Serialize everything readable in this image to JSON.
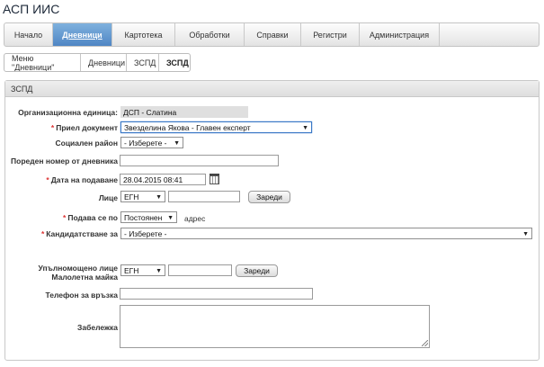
{
  "app": {
    "title": "АСП ИИС"
  },
  "nav": {
    "tabs": [
      {
        "label": "Начало"
      },
      {
        "label": "Дневници",
        "active": true
      },
      {
        "label": "Картотека"
      },
      {
        "label": "Обработки"
      },
      {
        "label": "Справки"
      },
      {
        "label": "Регистри"
      },
      {
        "label": "Администрация"
      }
    ]
  },
  "breadcrumb": [
    {
      "label": "Меню \"Дневници\""
    },
    {
      "label": "Дневници"
    },
    {
      "label": "ЗСПД"
    },
    {
      "label": "ЗСПД"
    }
  ],
  "panel": {
    "title": "ЗСПД"
  },
  "form": {
    "org_unit_label": "Организационна единица:",
    "org_unit_value": "ДСП - Слатина",
    "received_doc_label": "Приел документ",
    "received_doc_value": "Звезделина Якова - Главен експерт",
    "social_region_label": "Социален район",
    "social_region_value": "- Изберете -",
    "journal_number_label": "Пореден номер от дневника",
    "journal_number_value": "",
    "submission_date_label": "Дата на подаване",
    "submission_date_value": "28.04.2015 08:41",
    "person_label": "Лице",
    "person_id_type": "ЕГН",
    "person_id_value": "",
    "load_button": "Зареди",
    "submitted_by_label": "Подава се по",
    "submitted_by_value": "Постоянен",
    "address_suffix": "адрес",
    "application_label": "Кандидатстване за",
    "application_value": "- Изберете -",
    "authorized_label_line1": "Упълномощено лице",
    "authorized_label_line2": "Малолетна майка",
    "authorized_id_type": "ЕГН",
    "authorized_id_value": "",
    "authorized_load_button": "Зареди",
    "phone_label": "Телефон за връзка",
    "phone_value": "",
    "note_label": "Забележка",
    "note_value": ""
  },
  "colors": {
    "active_tab": "#4f86c4",
    "required_mark": "#dd3333",
    "focus_border": "#3a78c6"
  }
}
